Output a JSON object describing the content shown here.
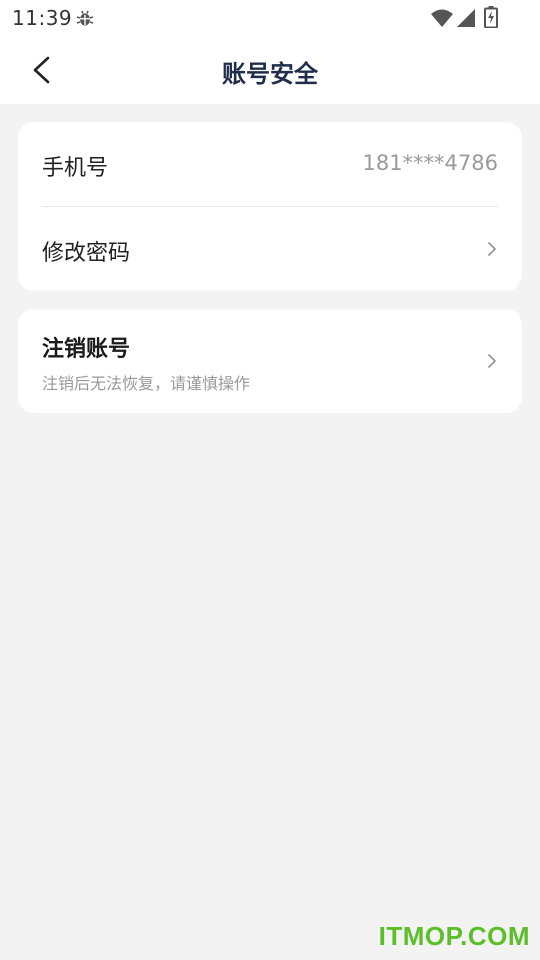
{
  "status_bar": {
    "time": "11:39",
    "icons": [
      "bug-icon",
      "wifi-icon",
      "signal-icon",
      "battery-charging-icon"
    ]
  },
  "header": {
    "title": "账号安全",
    "back_icon": "chevron-left-icon"
  },
  "account_card": {
    "phone_label": "手机号",
    "phone_value": "181****4786",
    "password_label": "修改密码",
    "chevron_icon": "chevron-right-icon"
  },
  "deactivate_card": {
    "title": "注销账号",
    "subtitle": "注销后无法恢复，请谨慎操作",
    "chevron_icon": "chevron-right-icon"
  },
  "watermark": {
    "text": "ITMOP.COM",
    "color": "#5cbf2a"
  },
  "colors": {
    "background": "#f3f3f3",
    "card": "#ffffff",
    "title": "#1f2d4a",
    "muted": "#9a9a9a"
  }
}
